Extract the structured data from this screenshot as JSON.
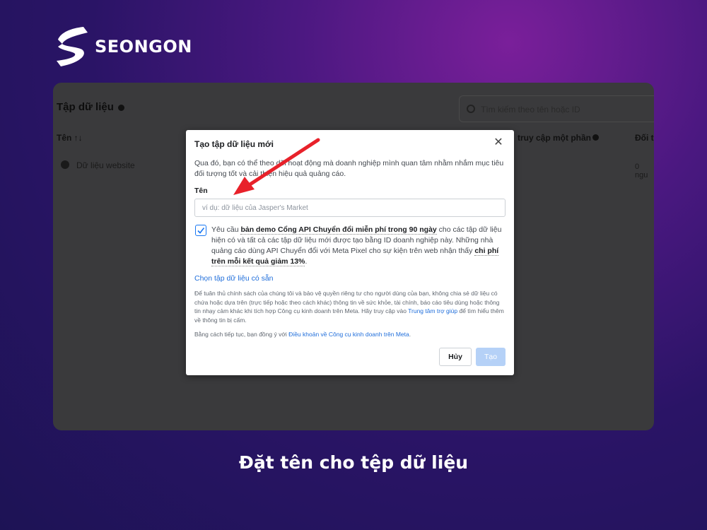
{
  "brand": {
    "name": "SEONGON",
    "logo_icon": "seongon-s-icon"
  },
  "background_page": {
    "title": "Tập dữ liệu",
    "search_placeholder": "Tìm kiếm theo tên hoặc ID",
    "columns": {
      "name": "Tên ↑↓",
      "access": "truy cập một phần",
      "partner": "Đối t"
    },
    "row": {
      "name": "Dữ liệu website",
      "partner_value": "0 ngu"
    }
  },
  "dialog": {
    "title": "Tạo tập dữ liệu mới",
    "description": "Qua đó, bạn có thể theo dõi hoạt động mà doanh nghiệp mình quan tâm nhằm nhắm mục tiêu đối tượng tốt và cải thiện hiệu quả quảng cáo.",
    "name_label": "Tên",
    "name_value": "",
    "name_placeholder": "ví dụ: dữ liệu của Jasper's Market",
    "consent_checked": true,
    "consent": {
      "prefix": "Yêu cầu ",
      "bold1": "bản demo Cổng API Chuyển đổi miễn phí trong 90 ngày",
      "middle": " cho các tập dữ liệu hiện có và tất cả các tập dữ liệu mới được tạo bằng ID doanh nghiệp này. Những nhà quảng cáo dùng API Chuyển đổi với Meta Pixel cho sự kiện trên web nhận thấy ",
      "bold2": "chi phí trên mỗi kết quả giảm 13%",
      "suffix": "."
    },
    "choose_existing": "Chọn tập dữ liệu có sẵn",
    "notice": {
      "text": "Để tuân thủ chính sách của chúng tôi và bảo vệ quyền riêng tư cho người dùng của bạn, không chia sẻ dữ liệu có chứa hoặc dựa trên (trực tiếp hoặc theo cách khác) thông tin về sức khỏe, tài chính, báo cáo tiêu dùng hoặc thông tin nhạy cảm khác khi tích hợp Công cụ kinh doanh trên Meta. Hãy truy cập vào ",
      "link": "Trung tâm trợ giúp",
      "suffix": " để tìm hiểu thêm về thông tin bị cấm."
    },
    "terms": {
      "text": "Bằng cách tiếp tục, bạn đồng ý với ",
      "link": "Điều khoản về Công cụ kinh doanh trên Meta",
      "suffix": "."
    },
    "cancel_label": "Hủy",
    "create_label": "Tạo"
  },
  "caption": "Đặt tên cho tệp dữ liệu",
  "colors": {
    "accent": "#1877f2",
    "arrow": "#e8212a",
    "disabled_button": "#b5d1f7"
  }
}
